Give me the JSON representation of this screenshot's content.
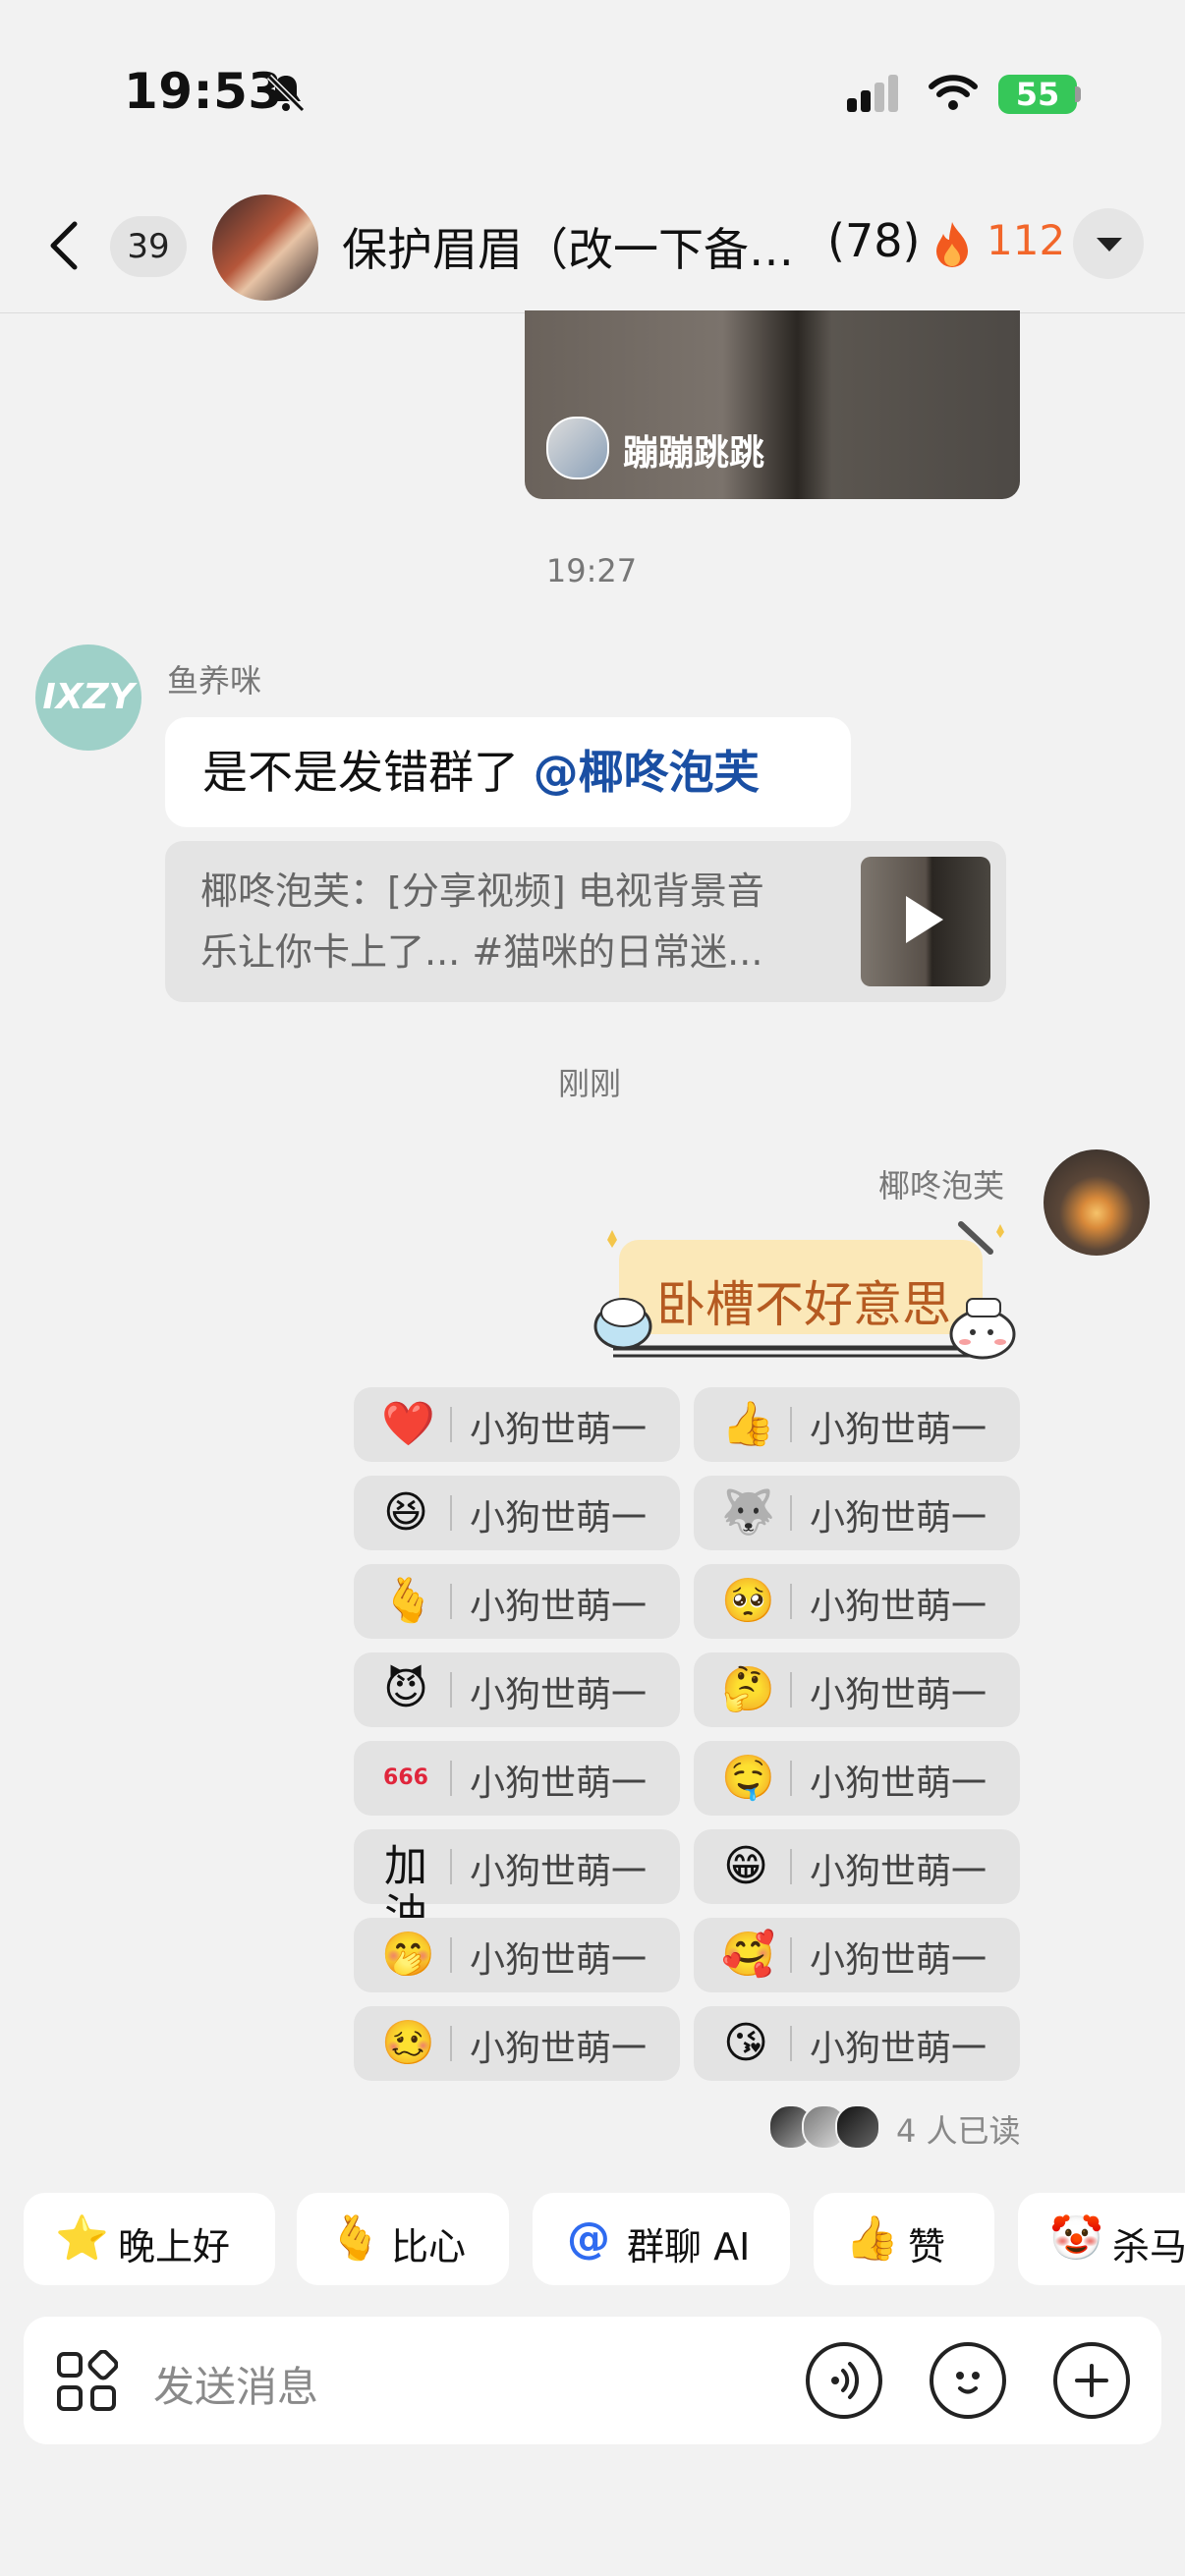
{
  "status_bar": {
    "time": "19:53",
    "battery": "55"
  },
  "header": {
    "unread_count": "39",
    "title": "保护眉眉（改一下备…",
    "member_count": "(78)",
    "streak": "112"
  },
  "top_video": {
    "user_name": "蹦蹦跳跳"
  },
  "timestamps": {
    "first": "19:27",
    "second": "刚刚"
  },
  "incoming": {
    "sender": "鱼养咪",
    "avatar_text": "IXZY",
    "text": "是不是发错群了",
    "mention": "@椰咚泡芙",
    "quote_line1": "椰咚泡芙：[分享视频] 电视背景音",
    "quote_line2": "乐让你卡上了... #猫咪的日常迷..."
  },
  "outgoing": {
    "sender": "椰咚泡芙",
    "sticker_text": "卧槽不好意思"
  },
  "reactions": [
    {
      "emoji": "❤️",
      "label": "小狗世萌一"
    },
    {
      "emoji": "👍",
      "label": "小狗世萌一"
    },
    {
      "emoji": "😆",
      "label": "小狗世萌一"
    },
    {
      "emoji": "🐺",
      "label": "小狗世萌一"
    },
    {
      "emoji": "🫰",
      "label": "小狗世萌一"
    },
    {
      "emoji": "🥺",
      "label": "小狗世萌一"
    },
    {
      "emoji": "😈",
      "label": "小狗世萌一"
    },
    {
      "emoji": "🤔",
      "label": "小狗世萌一"
    },
    {
      "emoji": "666",
      "label": "小狗世萌一"
    },
    {
      "emoji": "🤤",
      "label": "小狗世萌一"
    },
    {
      "emoji": "加油",
      "label": "小狗世萌一"
    },
    {
      "emoji": "😁",
      "label": "小狗世萌一"
    },
    {
      "emoji": "🤭",
      "label": "小狗世萌一"
    },
    {
      "emoji": "🥰",
      "label": "小狗世萌一"
    },
    {
      "emoji": "🥴",
      "label": "小狗世萌一"
    },
    {
      "emoji": "😘",
      "label": "小狗世萌一"
    }
  ],
  "read_receipt": "4 人已读",
  "quick_replies": [
    {
      "icon": "⭐",
      "label": "晚上好"
    },
    {
      "icon": "🫰",
      "label": "比心"
    },
    {
      "icon": "@",
      "label": "群聊 AI"
    },
    {
      "icon": "👍",
      "label": "赞"
    },
    {
      "icon": "🤡",
      "label": "杀马"
    }
  ],
  "input": {
    "placeholder": "发送消息"
  }
}
